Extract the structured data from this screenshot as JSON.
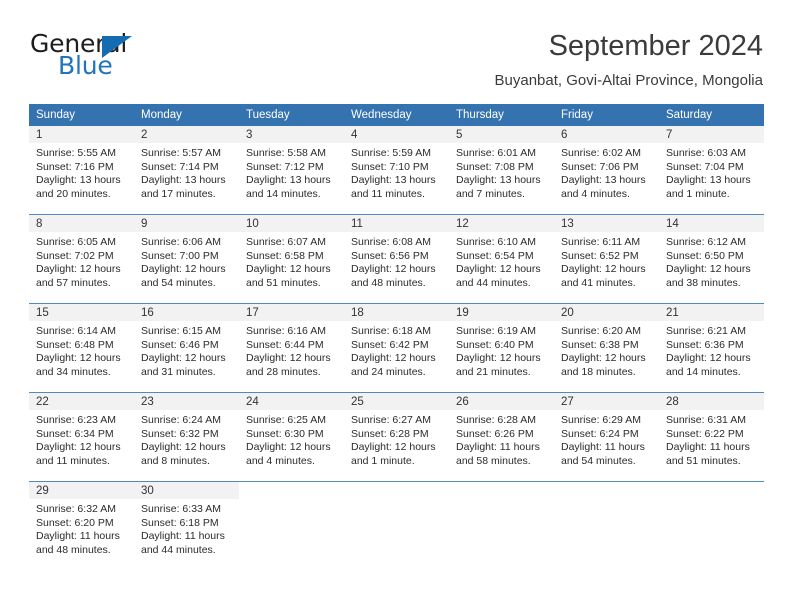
{
  "brand": {
    "word_one": "General",
    "word_two": "Blue",
    "triangle_color": "#156cb0",
    "blue_color": "#2175bb"
  },
  "header": {
    "title": "September 2024",
    "subtitle": "Buyanbat, Govi-Altai Province, Mongolia"
  },
  "theme": {
    "header_bg": "#3572b0",
    "daynum_band_bg": "#f2f2f2",
    "row_divider": "#5289bd"
  },
  "weekday_headers": [
    "Sunday",
    "Monday",
    "Tuesday",
    "Wednesday",
    "Thursday",
    "Friday",
    "Saturday"
  ],
  "weeks": [
    [
      {
        "day": "1",
        "sunrise": "Sunrise: 5:55 AM",
        "sunset": "Sunset: 7:16 PM",
        "daylight": "Daylight: 13 hours and 20 minutes."
      },
      {
        "day": "2",
        "sunrise": "Sunrise: 5:57 AM",
        "sunset": "Sunset: 7:14 PM",
        "daylight": "Daylight: 13 hours and 17 minutes."
      },
      {
        "day": "3",
        "sunrise": "Sunrise: 5:58 AM",
        "sunset": "Sunset: 7:12 PM",
        "daylight": "Daylight: 13 hours and 14 minutes."
      },
      {
        "day": "4",
        "sunrise": "Sunrise: 5:59 AM",
        "sunset": "Sunset: 7:10 PM",
        "daylight": "Daylight: 13 hours and 11 minutes."
      },
      {
        "day": "5",
        "sunrise": "Sunrise: 6:01 AM",
        "sunset": "Sunset: 7:08 PM",
        "daylight": "Daylight: 13 hours and 7 minutes."
      },
      {
        "day": "6",
        "sunrise": "Sunrise: 6:02 AM",
        "sunset": "Sunset: 7:06 PM",
        "daylight": "Daylight: 13 hours and 4 minutes."
      },
      {
        "day": "7",
        "sunrise": "Sunrise: 6:03 AM",
        "sunset": "Sunset: 7:04 PM",
        "daylight": "Daylight: 13 hours and 1 minute."
      }
    ],
    [
      {
        "day": "8",
        "sunrise": "Sunrise: 6:05 AM",
        "sunset": "Sunset: 7:02 PM",
        "daylight": "Daylight: 12 hours and 57 minutes."
      },
      {
        "day": "9",
        "sunrise": "Sunrise: 6:06 AM",
        "sunset": "Sunset: 7:00 PM",
        "daylight": "Daylight: 12 hours and 54 minutes."
      },
      {
        "day": "10",
        "sunrise": "Sunrise: 6:07 AM",
        "sunset": "Sunset: 6:58 PM",
        "daylight": "Daylight: 12 hours and 51 minutes."
      },
      {
        "day": "11",
        "sunrise": "Sunrise: 6:08 AM",
        "sunset": "Sunset: 6:56 PM",
        "daylight": "Daylight: 12 hours and 48 minutes."
      },
      {
        "day": "12",
        "sunrise": "Sunrise: 6:10 AM",
        "sunset": "Sunset: 6:54 PM",
        "daylight": "Daylight: 12 hours and 44 minutes."
      },
      {
        "day": "13",
        "sunrise": "Sunrise: 6:11 AM",
        "sunset": "Sunset: 6:52 PM",
        "daylight": "Daylight: 12 hours and 41 minutes."
      },
      {
        "day": "14",
        "sunrise": "Sunrise: 6:12 AM",
        "sunset": "Sunset: 6:50 PM",
        "daylight": "Daylight: 12 hours and 38 minutes."
      }
    ],
    [
      {
        "day": "15",
        "sunrise": "Sunrise: 6:14 AM",
        "sunset": "Sunset: 6:48 PM",
        "daylight": "Daylight: 12 hours and 34 minutes."
      },
      {
        "day": "16",
        "sunrise": "Sunrise: 6:15 AM",
        "sunset": "Sunset: 6:46 PM",
        "daylight": "Daylight: 12 hours and 31 minutes."
      },
      {
        "day": "17",
        "sunrise": "Sunrise: 6:16 AM",
        "sunset": "Sunset: 6:44 PM",
        "daylight": "Daylight: 12 hours and 28 minutes."
      },
      {
        "day": "18",
        "sunrise": "Sunrise: 6:18 AM",
        "sunset": "Sunset: 6:42 PM",
        "daylight": "Daylight: 12 hours and 24 minutes."
      },
      {
        "day": "19",
        "sunrise": "Sunrise: 6:19 AM",
        "sunset": "Sunset: 6:40 PM",
        "daylight": "Daylight: 12 hours and 21 minutes."
      },
      {
        "day": "20",
        "sunrise": "Sunrise: 6:20 AM",
        "sunset": "Sunset: 6:38 PM",
        "daylight": "Daylight: 12 hours and 18 minutes."
      },
      {
        "day": "21",
        "sunrise": "Sunrise: 6:21 AM",
        "sunset": "Sunset: 6:36 PM",
        "daylight": "Daylight: 12 hours and 14 minutes."
      }
    ],
    [
      {
        "day": "22",
        "sunrise": "Sunrise: 6:23 AM",
        "sunset": "Sunset: 6:34 PM",
        "daylight": "Daylight: 12 hours and 11 minutes."
      },
      {
        "day": "23",
        "sunrise": "Sunrise: 6:24 AM",
        "sunset": "Sunset: 6:32 PM",
        "daylight": "Daylight: 12 hours and 8 minutes."
      },
      {
        "day": "24",
        "sunrise": "Sunrise: 6:25 AM",
        "sunset": "Sunset: 6:30 PM",
        "daylight": "Daylight: 12 hours and 4 minutes."
      },
      {
        "day": "25",
        "sunrise": "Sunrise: 6:27 AM",
        "sunset": "Sunset: 6:28 PM",
        "daylight": "Daylight: 12 hours and 1 minute."
      },
      {
        "day": "26",
        "sunrise": "Sunrise: 6:28 AM",
        "sunset": "Sunset: 6:26 PM",
        "daylight": "Daylight: 11 hours and 58 minutes."
      },
      {
        "day": "27",
        "sunrise": "Sunrise: 6:29 AM",
        "sunset": "Sunset: 6:24 PM",
        "daylight": "Daylight: 11 hours and 54 minutes."
      },
      {
        "day": "28",
        "sunrise": "Sunrise: 6:31 AM",
        "sunset": "Sunset: 6:22 PM",
        "daylight": "Daylight: 11 hours and 51 minutes."
      }
    ],
    [
      {
        "day": "29",
        "sunrise": "Sunrise: 6:32 AM",
        "sunset": "Sunset: 6:20 PM",
        "daylight": "Daylight: 11 hours and 48 minutes."
      },
      {
        "day": "30",
        "sunrise": "Sunrise: 6:33 AM",
        "sunset": "Sunset: 6:18 PM",
        "daylight": "Daylight: 11 hours and 44 minutes."
      },
      {
        "day": "",
        "sunrise": "",
        "sunset": "",
        "daylight": ""
      },
      {
        "day": "",
        "sunrise": "",
        "sunset": "",
        "daylight": ""
      },
      {
        "day": "",
        "sunrise": "",
        "sunset": "",
        "daylight": ""
      },
      {
        "day": "",
        "sunrise": "",
        "sunset": "",
        "daylight": ""
      },
      {
        "day": "",
        "sunrise": "",
        "sunset": "",
        "daylight": ""
      }
    ]
  ]
}
